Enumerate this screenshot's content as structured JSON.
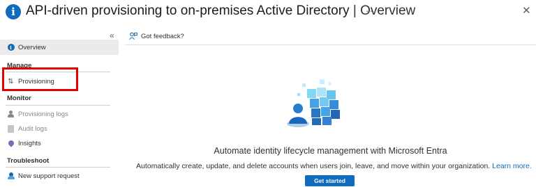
{
  "header": {
    "title": "API-driven provisioning to on-premises Active Directory",
    "separator": "|",
    "subtitle": "Overview",
    "more": "···",
    "close": "✕",
    "icon": "info-icon"
  },
  "sidebar": {
    "collapse": "«",
    "overview": "Overview",
    "sections": {
      "manage": "Manage",
      "monitor": "Monitor",
      "troubleshoot": "Troubleshoot"
    },
    "items": {
      "provisioning": "Provisioning",
      "provisioning_logs": "Provisioning logs",
      "audit_logs": "Audit logs",
      "insights": "Insights",
      "new_support_request": "New support request"
    },
    "highlight_color": "#e00000"
  },
  "toolbar": {
    "feedback": "Got feedback?"
  },
  "main": {
    "headline": "Automate identity lifecycle management with Microsoft Entra",
    "description": "Automatically create, update, and delete accounts when users join, leave, and move within your organization.",
    "learn_more": "Learn more.",
    "get_started": "Get started"
  },
  "colors": {
    "accent": "#0f6cbd",
    "selected_bg": "#edebe9"
  }
}
